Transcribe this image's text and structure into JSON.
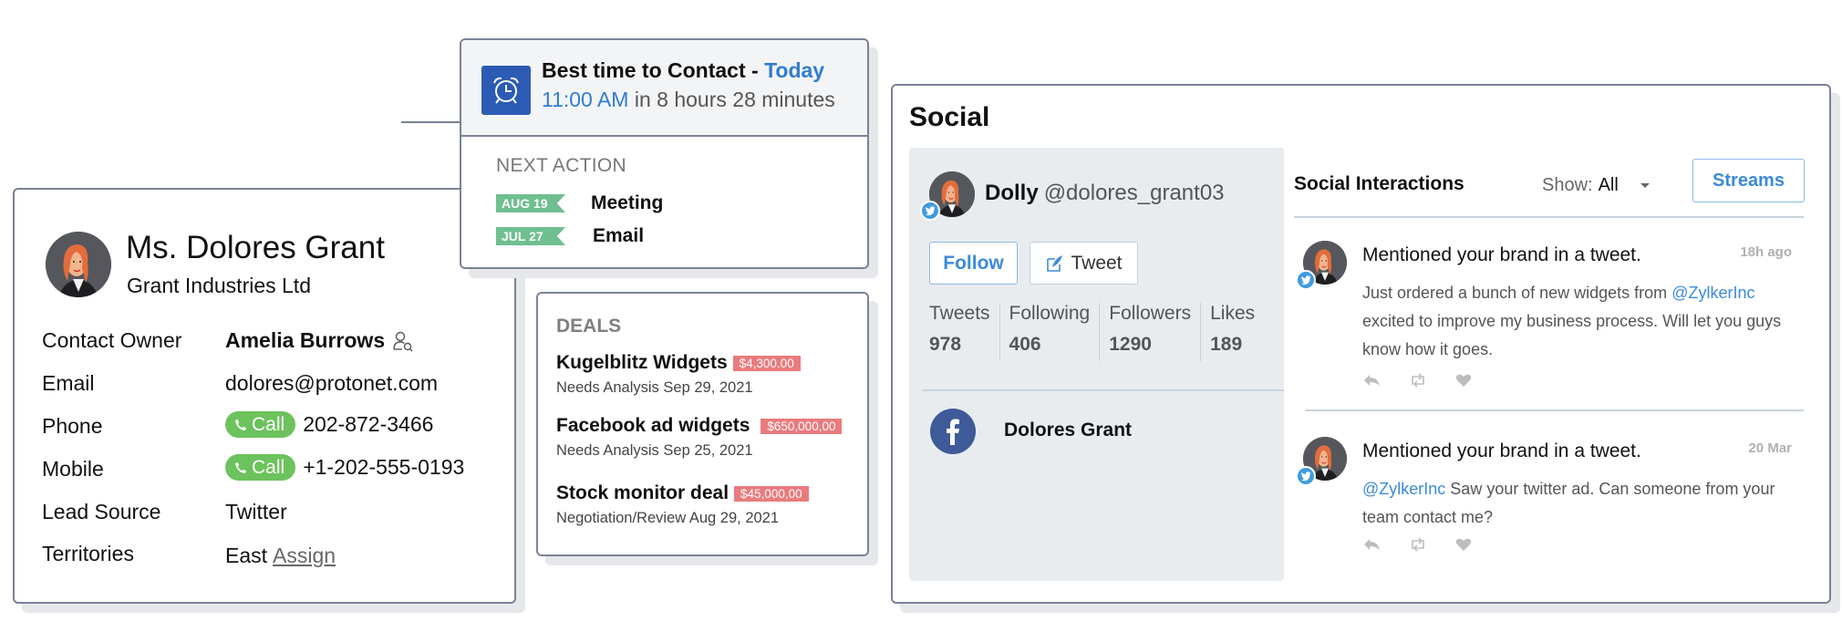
{
  "contact": {
    "name": "Ms. Dolores Grant",
    "company": "Grant Industries Ltd",
    "fields": [
      {
        "label": "Contact Owner",
        "value": "Amelia Burrows"
      },
      {
        "label": "Email",
        "value": "dolores@protonet.com"
      },
      {
        "label": "Phone",
        "value": "202-872-3466",
        "action": "Call"
      },
      {
        "label": "Mobile",
        "value": "+1-202-555-0193",
        "action": "Call"
      },
      {
        "label": "Lead Source",
        "value": "Twitter"
      },
      {
        "label": "Territories",
        "value": "East",
        "link": "Assign"
      }
    ]
  },
  "best_time": {
    "title": "Best time to Contact -",
    "day": "Today",
    "time": "11:00 AM",
    "countdown": "in 8 hours 28 minutes",
    "next_action_title": "NEXT ACTION",
    "actions": [
      {
        "date": "AUG 19",
        "label": "Meeting"
      },
      {
        "date": "JUL 27",
        "label": "Email"
      }
    ]
  },
  "deals": {
    "title": "DEALS",
    "items": [
      {
        "name": "Kugelblitz Widgets",
        "amount": "$4,300.00",
        "stage": "Needs Analysis",
        "date": "Sep 29, 2021"
      },
      {
        "name": "Facebook ad widgets",
        "amount": "$650,000,00",
        "stage": "Needs Analysis",
        "date": "Sep 25, 2021"
      },
      {
        "name": "Stock monitor deal",
        "amount": "$45,000,00",
        "stage": "Negotiation/Review",
        "date": "Aug 29, 2021"
      }
    ]
  },
  "social": {
    "title": "Social",
    "profile": {
      "name": "Dolly",
      "handle": "@dolores_grant03",
      "follow_label": "Follow",
      "tweet_label": "Tweet",
      "stats": [
        {
          "label": "Tweets",
          "value": "978"
        },
        {
          "label": "Following",
          "value": "406"
        },
        {
          "label": "Followers",
          "value": "1290"
        },
        {
          "label": "Likes",
          "value": "189"
        }
      ],
      "facebook_name": "Dolores Grant"
    },
    "interactions": {
      "title": "Social Interactions",
      "show_label": "Show:",
      "show_value": "All",
      "streams_label": "Streams",
      "items": [
        {
          "title": "Mentioned your brand in a tweet.",
          "time": "18h ago",
          "body_before": "Just ordered a bunch of new widgets from ",
          "mention": "@ZylkerInc",
          "body_after": " excited to improve my business process. Will let you guys know how it goes."
        },
        {
          "title": "Mentioned your brand in a tweet.",
          "time": "20 Mar",
          "body_before": "",
          "mention": "@ZylkerInc",
          "body_after": " Saw your twitter ad. Can someone from your team contact me?"
        }
      ]
    }
  },
  "colors": {
    "accent_blue": "#2f7ccf",
    "call_green": "#6cc25d",
    "date_flag_green": "#6fbf90",
    "deal_amount_red": "#e97b7e",
    "alarm_blue": "#2b5bb4",
    "facebook_blue": "#3f5a98",
    "twitter_blue": "#3f9be0"
  }
}
